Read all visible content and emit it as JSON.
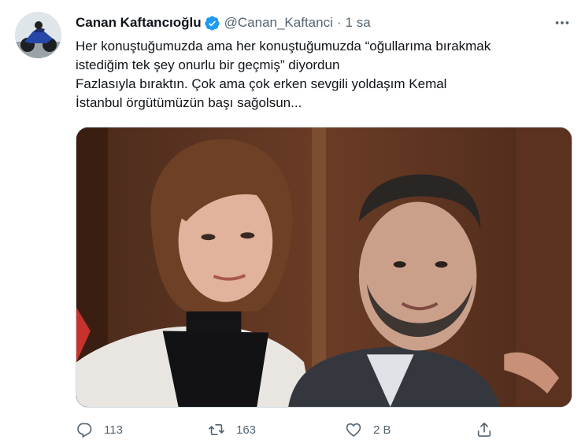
{
  "author": {
    "display_name": "Canan Kaftancıoğlu",
    "handle": "@Canan_Kaftanci",
    "separator": "·",
    "time": "1 sa"
  },
  "tweet": {
    "text_lines": [
      "Her konuştuğumuzda ama her konuştuğumuzda “oğullarıma bırakmak",
      "istediğim tek şey onurlu bir geçmiş” diyordun",
      "Fazlasıyla bıraktın. Çok ama çok erken sevgili yoldaşım Kemal",
      "İstanbul örgütümüzün başı sağolsun..."
    ]
  },
  "actions": {
    "reply": {
      "icon": "reply-icon",
      "count": "113"
    },
    "retweet": {
      "icon": "retweet-icon",
      "count": "163"
    },
    "like": {
      "icon": "heart-icon",
      "count": "2 B"
    },
    "share": {
      "icon": "share-icon"
    }
  },
  "colors": {
    "text": "#0f1419",
    "secondary": "#536471",
    "verified": "#1d9bf0",
    "border": "#cfd9de"
  }
}
